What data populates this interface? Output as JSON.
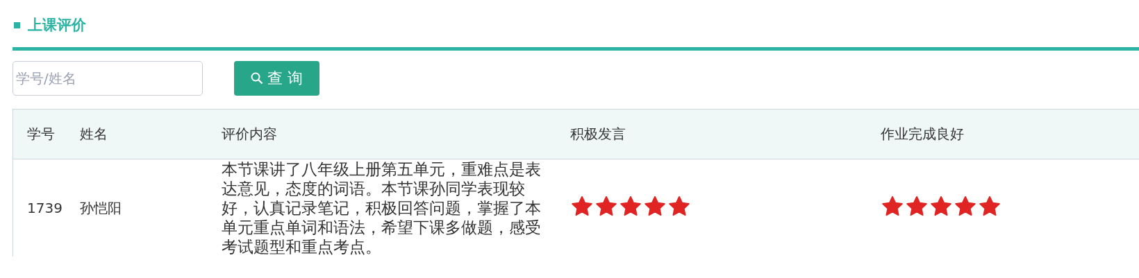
{
  "section": {
    "title": "上课评价"
  },
  "search": {
    "placeholder": "学号/姓名",
    "button": "查 询"
  },
  "table": {
    "columns": [
      "学号",
      "姓名",
      "评价内容",
      "积极发言",
      "作业完成良好"
    ],
    "rows": [
      {
        "id": "1739",
        "name": "孙恺阳",
        "comment": "本节课讲了八年级上册第五单元，重难点是表达意见，态度的词语。本节课孙同学表现较好，认真记录笔记，积极回答问题，掌握了本单元重点单词和语法，希望下课多做题，感受考试题型和重点考点。",
        "ratings": [
          {
            "stars": 5
          },
          {
            "stars": 5
          }
        ]
      }
    ]
  }
}
